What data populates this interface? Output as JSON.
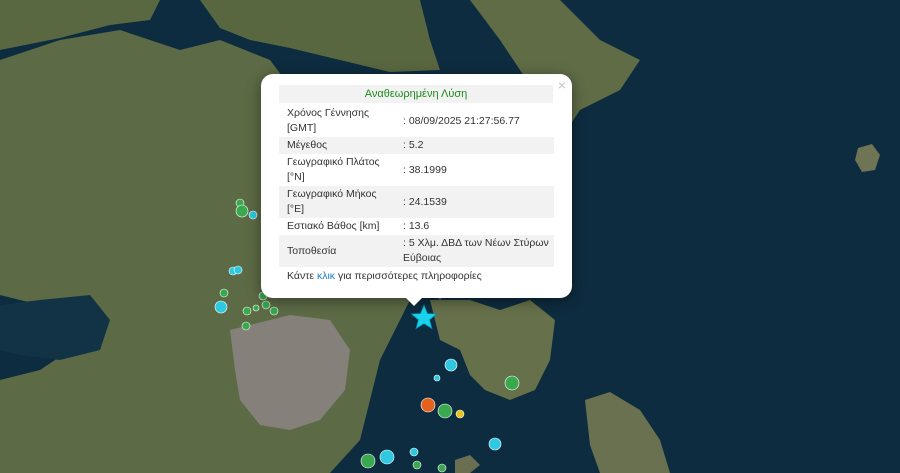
{
  "popup": {
    "title": "Αναθεωρημένη Λύση",
    "close": "×",
    "rows": [
      {
        "label": "Χρόνος Γέννησης\n[GMT]",
        "value": ": 08/09/2025 21:27:56.77"
      },
      {
        "label": "Μέγεθος",
        "value": ": 5.2"
      },
      {
        "label": "Γεωγραφικό Πλάτος\n[°N]",
        "value": ": 38.1999"
      },
      {
        "label": "Γεωγραφικό Μήκος\n[°E]",
        "value": ": 24.1539"
      },
      {
        "label": "Εστιακό Βάθος [km]",
        "value": ": 13.6"
      },
      {
        "label": "Τοποθεσία",
        "value": ": 5 Χλμ. ΔΒΔ των Νέων Στύρων\nΕύβοιας"
      }
    ],
    "more_prefix": "Κάντε ",
    "more_link": "κλικ",
    "more_suffix": " για περισσότερες πληροφορίες"
  },
  "colors": {
    "sea": "#0e2c3f",
    "land": "#5f6b48",
    "city": "#8a8478",
    "title_green": "#1e8a1e",
    "link_blue": "#1a7fc7",
    "star": "#19d3ee",
    "event_cyan": "#2ec8e0",
    "event_green": "#3aa84f",
    "event_orange": "#e5621e",
    "event_yellow": "#e5c21e"
  },
  "events": {
    "main": {
      "icon": "star-icon"
    },
    "recent": [
      {
        "color": "cyan"
      },
      {
        "color": "green"
      },
      {
        "color": "green"
      },
      {
        "color": "cyan"
      },
      {
        "color": "cyan"
      },
      {
        "color": "green"
      },
      {
        "color": "green"
      },
      {
        "color": "cyan"
      },
      {
        "color": "green"
      },
      {
        "color": "green"
      },
      {
        "color": "green"
      },
      {
        "color": "green"
      },
      {
        "color": "green"
      },
      {
        "color": "cyan"
      },
      {
        "color": "cyan"
      },
      {
        "color": "cyan"
      },
      {
        "color": "orange"
      },
      {
        "color": "green"
      },
      {
        "color": "yellow"
      },
      {
        "color": "green"
      },
      {
        "color": "cyan"
      },
      {
        "color": "green"
      },
      {
        "color": "cyan"
      },
      {
        "color": "green"
      },
      {
        "color": "green"
      }
    ]
  }
}
